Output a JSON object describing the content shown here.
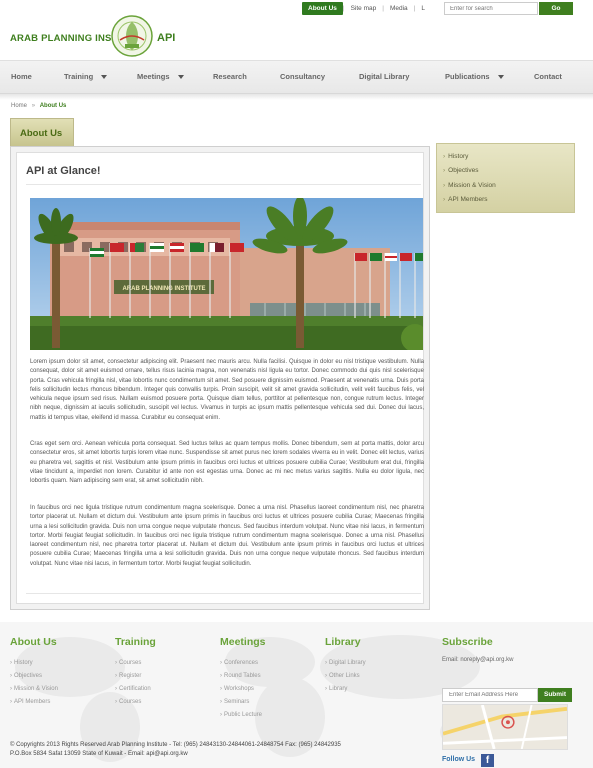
{
  "topbar": {
    "links": [
      "About Us",
      "Site map",
      "Media",
      "L"
    ],
    "search_placeholder": "Enter for search",
    "search_button": "Go"
  },
  "logo": {
    "left_text": "ARAB PLANNING INSTITUTE",
    "right_text": "API"
  },
  "nav": {
    "items": [
      "Home",
      "Training",
      "Meetings",
      "Research",
      "Consultancy",
      "Digital Library",
      "Publications",
      "Contact"
    ]
  },
  "breadcrumb": {
    "home": "Home",
    "separator": "»",
    "current": "About Us"
  },
  "tab": {
    "label": "About Us"
  },
  "content": {
    "title": "API at Glance!",
    "photo_sign": "ARAB PLANNING INSTITUTE",
    "paragraphs": [
      "Lorem ipsum dolor sit amet, consectetur adipiscing elit. Praesent nec mauris arcu. Nulla facilisi. Quisque in dolor eu nisl tristique vestibulum. Nulla consequat, dolor sit amet euismod ornare, tellus risus lacinia magna, non venenatis nisl ligula eu tortor. Donec commodo dui quis nisl scelerisque porta. Cras vehicula fringilla nisl, vitae lobortis nunc condimentum sit amet. Sed posuere dignissim euismod. Praesent at venenatis urna. Duis porta felis sollicitudin lectus rhoncus bibendum. Integer quis convallis turpis. Proin suscipit, velit sit amet gravida sollicitudin, velit velit faucibus felis, vel vehicula neque ipsum sed risus. Nullam euismod posuere porta. Quisque diam tellus, porttitor at pellentesque non, congue rutrum lectus. Integer nibh neque, dignissim at iaculis sollicitudin, suscipit vel lectus. Vivamus in turpis ac ipsum mattis pellentesque vehicula sed dui. Donec dui lacus, mattis id tempus vitae, eleifend id massa. Curabitur eu consequat enim.",
      "Cras eget sem orci. Aenean vehicula porta consequat. Sed luctus tellus ac quam tempus mollis. Donec bibendum, sem at porta mattis, dolor arcu consectetur eros, sit amet lobortis turpis lorem vitae nunc. Suspendisse sit amet purus nec lorem sodales viverra eu in velit. Donec elit lectus, varius eu pharetra vel, sagittis et nisl. Vestibulum ante ipsum primis in faucibus orci luctus et ultrices posuere cubilia Curae; Vestibulum erat dui, fringilla vitae tincidunt a, imperdiet non lorem. Curabitur id ante non est egestas urna. Donec ac mi nec metus varius sagittis. Nulla eu dolor ligula, nec lobortis quam. Nam adipiscing sem erat, sit amet sollicitudin nibh.",
      "In faucibus orci nec ligula tristique rutrum condimentum magna scelerisque. Donec a urna nisl. Phasellus laoreet condimentum nisl, nec pharetra tortor placerat ut. Nullam et dictum dui. Vestibulum ante ipsum primis in faucibus orci luctus et ultrices posuere cubilia Curae; Maecenas fringilla urna a lesi sollicitudin gravida. Duis non urna congue neque vulputate rhoncus. Sed faucibus interdum volutpat. Nunc vitae nisi lacus, in fermentum tortor. Morbi feugiat feugiat sollicitudin. In faucibus orci nec ligula tristique rutrum condimentum magna scelerisque. Donec a urna nisl. Phasellus laoreet condimentum nisl, nec pharetra tortor placerat ut. Nullam et dictum dui. Vestibulum ante ipsum primis in faucibus orci luctus et ultrices posuere cubilia Curae; Maecenas fringilla urna a lesi sollicitudin gravida. Duis non urna congue neque vulputate rhoncus. Sed faucibus interdum volutpat. Nunc vitae nisi lacus, in fermentum tortor. Morbi feugiat feugiat sollicitudin."
    ]
  },
  "sidebar": {
    "items": [
      "History",
      "Objectives",
      "Mission & Vision",
      "API Members"
    ]
  },
  "footer": {
    "about": {
      "title": "About Us",
      "links": [
        "History",
        "Objectives",
        "Mission & Vision",
        "API Members"
      ]
    },
    "training": {
      "title": "Training",
      "links": [
        "Courses",
        "Register",
        "Certification",
        "Courses"
      ]
    },
    "meetings": {
      "title": "Meetings",
      "links": [
        "Conferences",
        "Round Tables",
        "Workshops",
        "Seminars",
        "Public Lecture"
      ]
    },
    "library": {
      "title": "Library",
      "links": [
        "Digital Library",
        "Other Links",
        "Library"
      ]
    },
    "subscribe": {
      "title": "Subscribe",
      "email_label": "Email: noreply@api.org.kw",
      "input_placeholder": "Enter Email Address Here",
      "button": "Submit",
      "follow": "Follow Us",
      "fb": "f"
    },
    "copyright_line1": "© Copyrights 2013 Rights Reserved Arab Planning Institute - Tel: (965) 24843130-24844061-24848754 Fax: (965) 24842935",
    "copyright_line2": "P.O.Box 5834 Safat 13059 State of Kuwait - Email: api@api.org.kw"
  },
  "colors": {
    "brand_green": "#3f7f1f",
    "footer_heading": "#6aa33a",
    "tab_khaki": "#c7c48e"
  }
}
